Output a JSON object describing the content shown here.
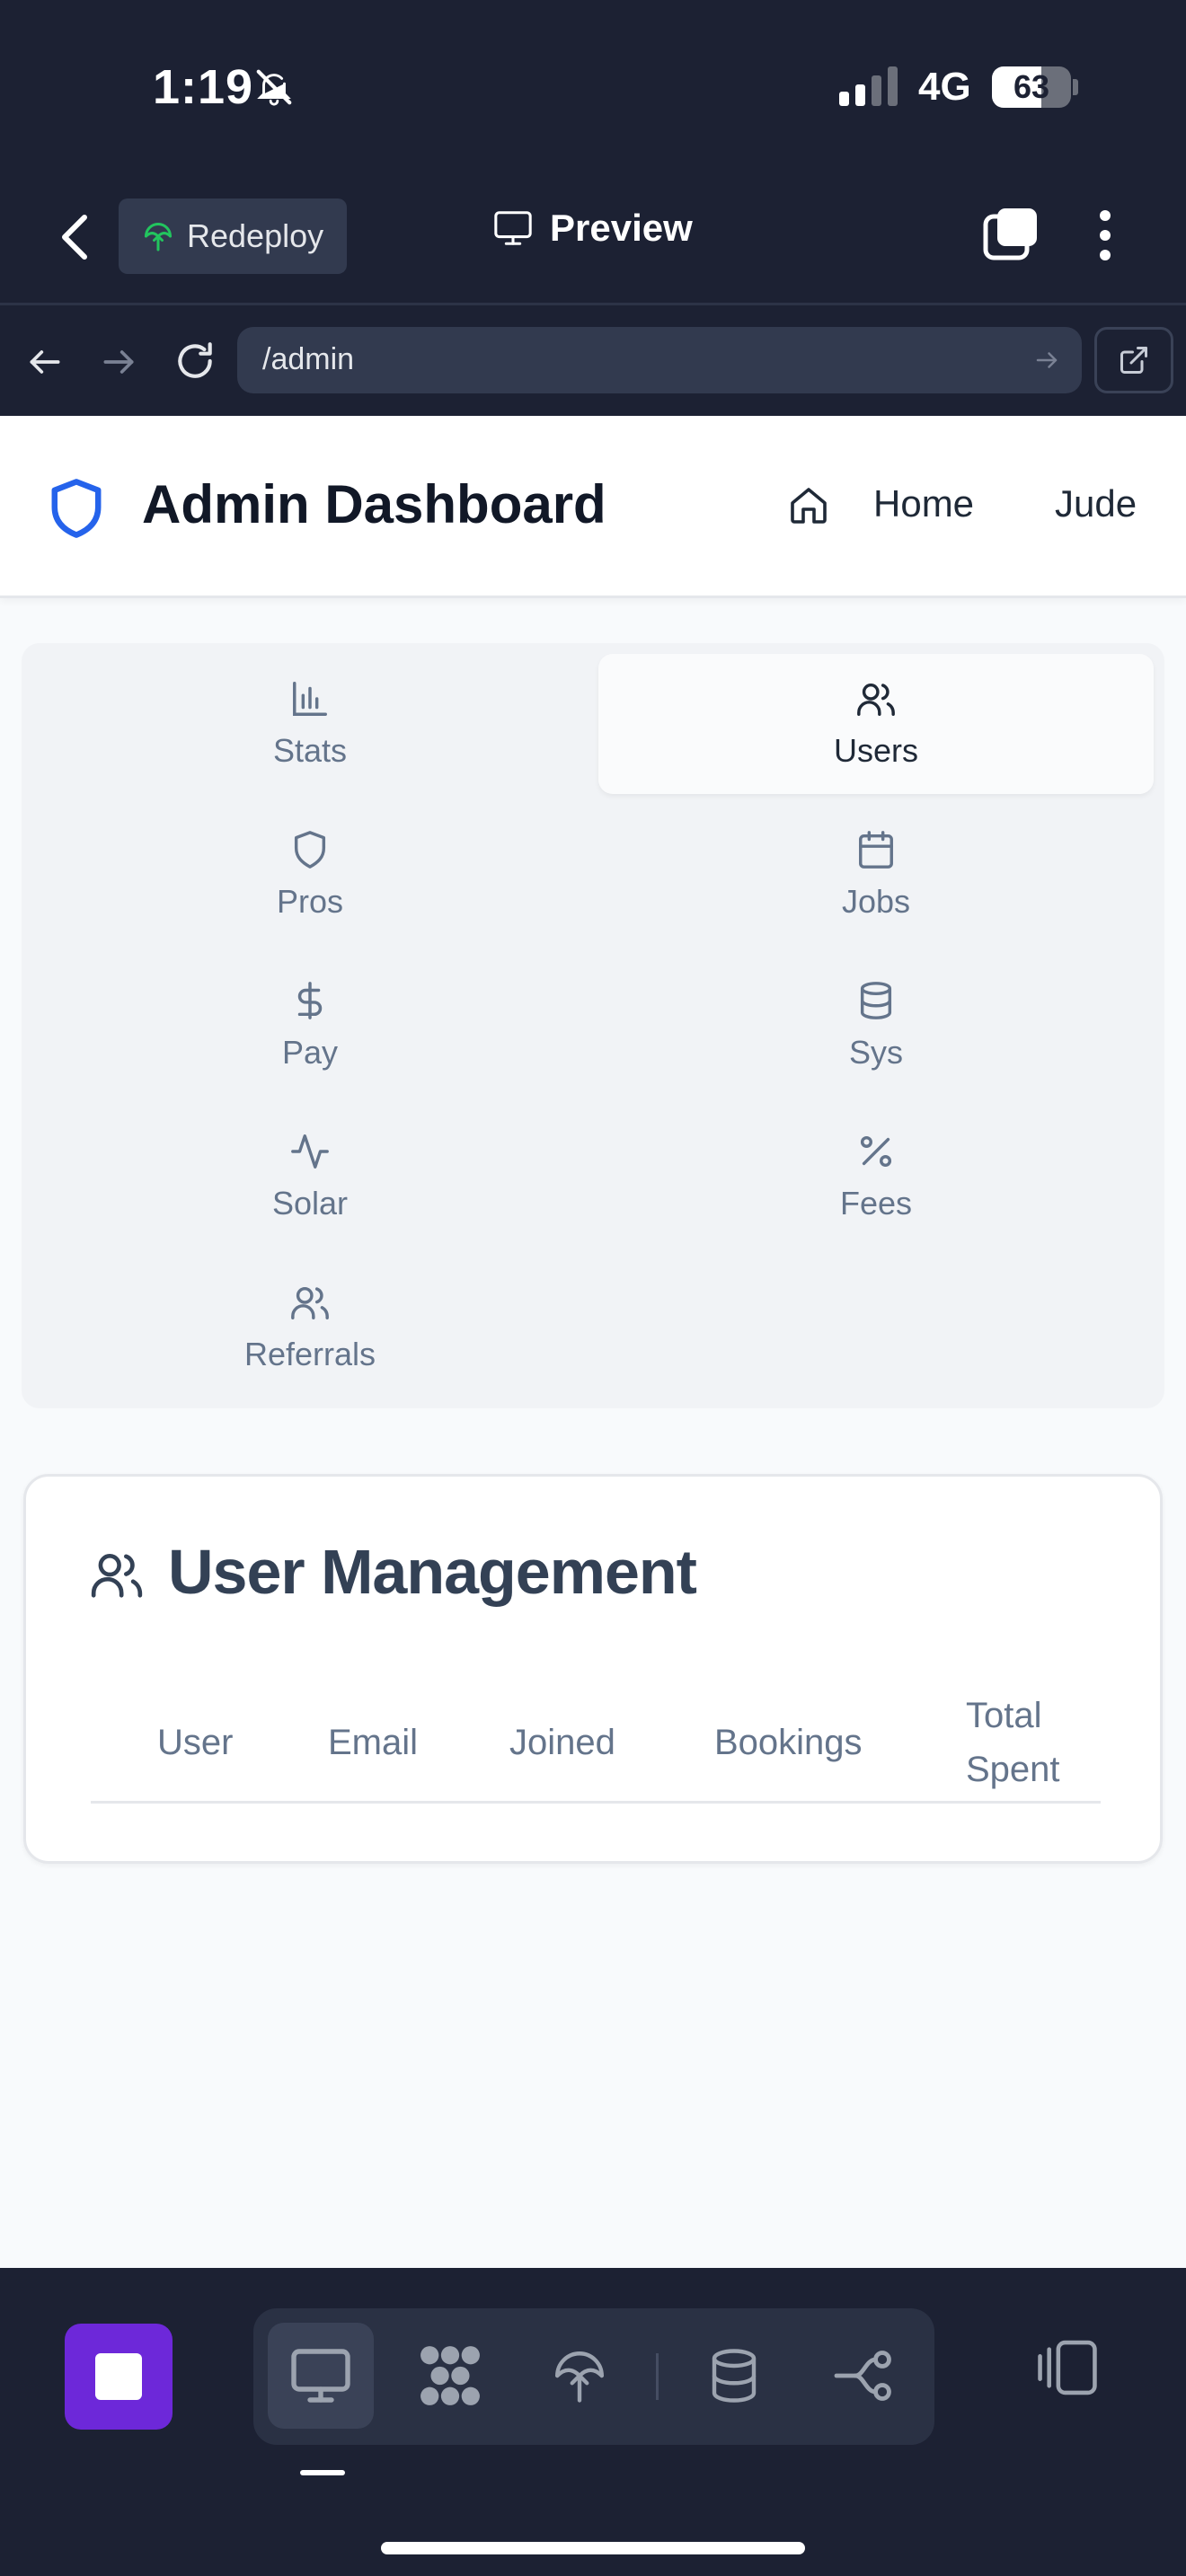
{
  "status_bar": {
    "time": "1:19",
    "network": "4G",
    "battery_percent": "63",
    "battery_level": 0.63
  },
  "app_toolbar": {
    "redeploy_label": "Redeploy",
    "preview_label": "Preview"
  },
  "address_bar": {
    "url": "/admin"
  },
  "header": {
    "title": "Admin Dashboard",
    "home_label": "Home",
    "user_name": "Jude"
  },
  "nav": {
    "items": [
      {
        "label": "Stats",
        "icon": "bar-chart-icon",
        "active": false
      },
      {
        "label": "Users",
        "icon": "users-icon",
        "active": true
      },
      {
        "label": "Pros",
        "icon": "shield-icon",
        "active": false
      },
      {
        "label": "Jobs",
        "icon": "calendar-icon",
        "active": false
      },
      {
        "label": "Pay",
        "icon": "dollar-icon",
        "active": false
      },
      {
        "label": "Sys",
        "icon": "database-icon",
        "active": false
      },
      {
        "label": "Solar",
        "icon": "activity-icon",
        "active": false
      },
      {
        "label": "Fees",
        "icon": "percent-icon",
        "active": false
      },
      {
        "label": "Referrals",
        "icon": "users-icon",
        "active": false
      }
    ]
  },
  "user_management": {
    "title": "User Management",
    "columns": [
      "User",
      "Email",
      "Joined",
      "Bookings",
      "Total",
      "Spent"
    ]
  },
  "colors": {
    "accent": "#2563eb",
    "dark_chrome": "#1c2133",
    "stop_button": "#6d28d9",
    "redeploy_icon": "#22c55e"
  }
}
